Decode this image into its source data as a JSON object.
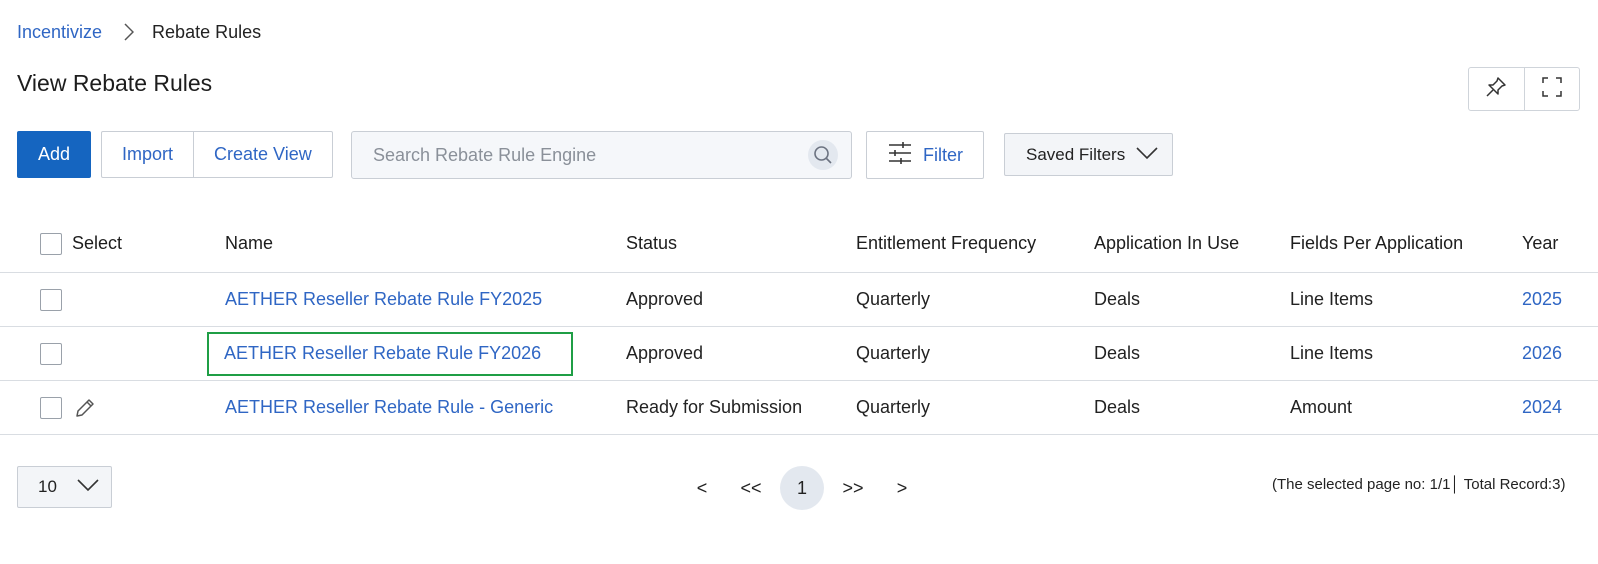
{
  "breadcrumb": {
    "root": "Incentivize",
    "current": "Rebate Rules"
  },
  "page": {
    "title": "View Rebate Rules"
  },
  "toolbar": {
    "add_label": "Add",
    "import_label": "Import",
    "create_view_label": "Create View",
    "search_placeholder": "Search Rebate Rule Engine",
    "search_value": "",
    "filter_label": "Filter",
    "saved_filters_label": "Saved Filters"
  },
  "icons": {
    "pin": "pin-icon",
    "fullscreen": "fullscreen-icon",
    "search": "search-icon",
    "filter": "sliders-icon",
    "chevron": "chevron-down-icon",
    "edit": "pencil-icon",
    "breadcrumb_sep": "chevron-right-icon"
  },
  "table": {
    "columns": {
      "select": "Select",
      "name": "Name",
      "status": "Status",
      "frequency": "Entitlement Frequency",
      "application": "Application In Use",
      "fields": "Fields Per Application",
      "year": "Year"
    },
    "rows": [
      {
        "name": "AETHER Reseller Rebate Rule FY2025",
        "status": "Approved",
        "frequency": "Quarterly",
        "application": "Deals",
        "fields": "Line Items",
        "year": "2025",
        "editable": false,
        "highlighted": false
      },
      {
        "name": "AETHER Reseller Rebate Rule FY2026",
        "status": "Approved",
        "frequency": "Quarterly",
        "application": "Deals",
        "fields": "Line Items",
        "year": "2026",
        "editable": false,
        "highlighted": true
      },
      {
        "name": "AETHER Reseller Rebate Rule - Generic",
        "status": "Ready for Submission",
        "frequency": "Quarterly",
        "application": "Deals",
        "fields": "Amount",
        "year": "2024",
        "editable": true,
        "highlighted": false
      }
    ]
  },
  "pagination": {
    "page_size": "10",
    "prev": "<",
    "first": "<<",
    "current": "1",
    "last": ">>",
    "next": ">",
    "info": "(The selected page no: 1/1│ Total Record:3)"
  },
  "colors": {
    "accent": "#1565c0",
    "link": "#2f66c4",
    "highlight": "#1f9e45"
  }
}
